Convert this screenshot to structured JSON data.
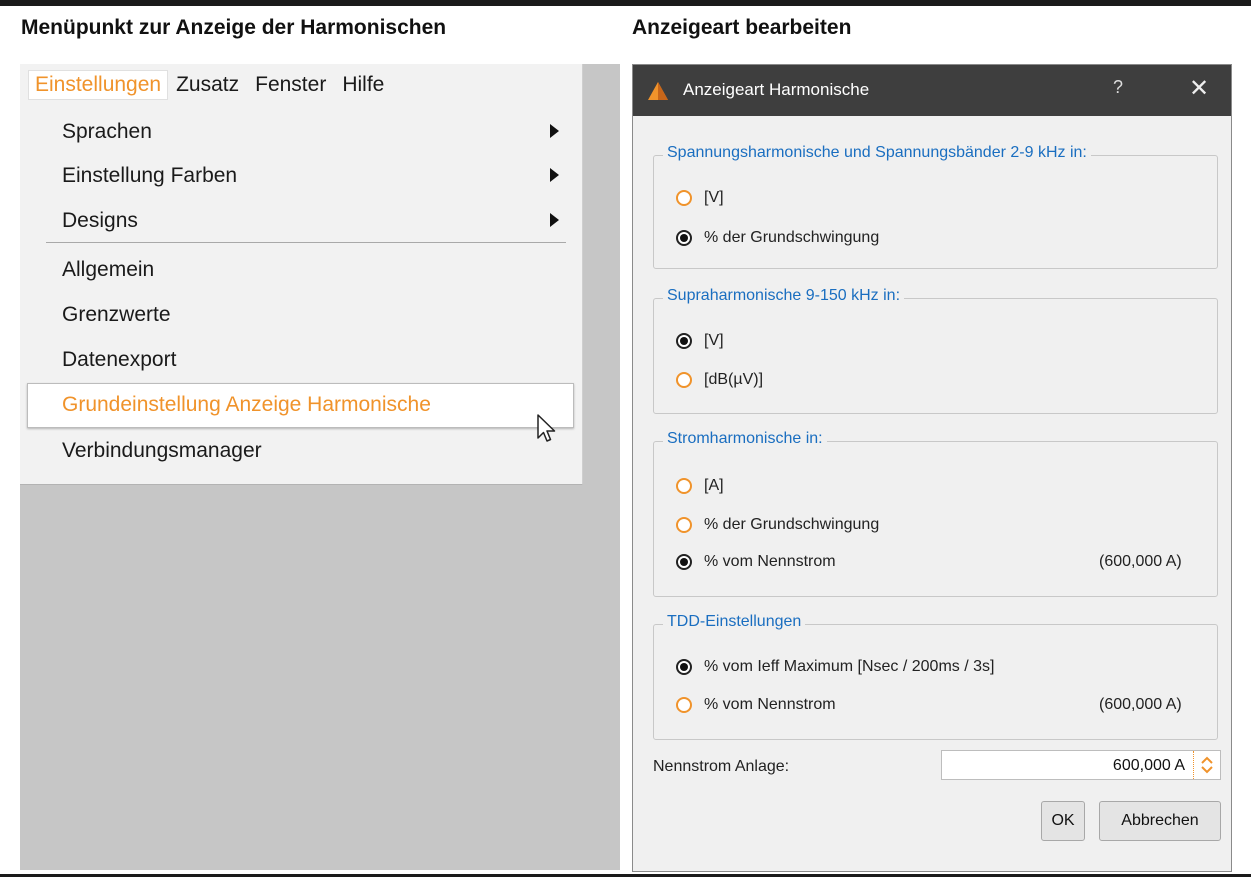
{
  "captions": {
    "left": "Menüpunkt zur Anzeige der Harmonischen",
    "right": "Anzeigeart bearbeiten"
  },
  "menubar": {
    "items": [
      "Einstellungen",
      "Zusatz",
      "Fenster",
      "Hilfe"
    ],
    "active": "Einstellungen"
  },
  "menu": {
    "items": [
      {
        "label": "Sprachen",
        "submenu": true
      },
      {
        "label": "Einstellung Farben",
        "submenu": true
      },
      {
        "label": "Designs",
        "submenu": true
      },
      {
        "label": "Allgemein",
        "submenu": false
      },
      {
        "label": "Grenzwerte",
        "submenu": false
      },
      {
        "label": "Datenexport",
        "submenu": false
      },
      {
        "label": "Grundeinstellung Anzeige Harmonische",
        "submenu": false,
        "highlighted": true
      },
      {
        "label": "Verbindungsmanager",
        "submenu": false
      }
    ]
  },
  "dialog": {
    "title": "Anzeigeart Harmonische",
    "help": "?",
    "close": "✕",
    "groups": [
      {
        "legend": "Spannungsharmonische und Spannungsbänder 2-9 kHz in:",
        "options": [
          {
            "label": "[V]",
            "selected": false
          },
          {
            "label": "% der Grundschwingung",
            "selected": true
          }
        ]
      },
      {
        "legend": "Supraharmonische 9-150 kHz in:",
        "options": [
          {
            "label": "[V]",
            "selected": true
          },
          {
            "label": "[dB(µV)]",
            "selected": false
          }
        ]
      },
      {
        "legend": "Stromharmonische in:",
        "options": [
          {
            "label": "[A]",
            "selected": false
          },
          {
            "label": "% der Grundschwingung",
            "selected": false
          },
          {
            "label": "% vom Nennstrom",
            "selected": true,
            "value": "(600,000 A)"
          }
        ]
      },
      {
        "legend": "TDD-Einstellungen",
        "options": [
          {
            "label": "% vom Ieff Maximum [Nsec / 200ms / 3s]",
            "selected": true
          },
          {
            "label": "% vom Nennstrom",
            "selected": false,
            "value": "(600,000 A)"
          }
        ]
      }
    ],
    "nennstrom": {
      "label": "Nennstrom Anlage:",
      "value": "600,000 A"
    },
    "buttons": {
      "ok": "OK",
      "cancel": "Abbrechen"
    }
  },
  "colors": {
    "accent": "#f0932b",
    "legend_blue": "#1a6ec0",
    "titlebar": "#3e3e3e",
    "panel_grey": "#c6c6c6"
  }
}
